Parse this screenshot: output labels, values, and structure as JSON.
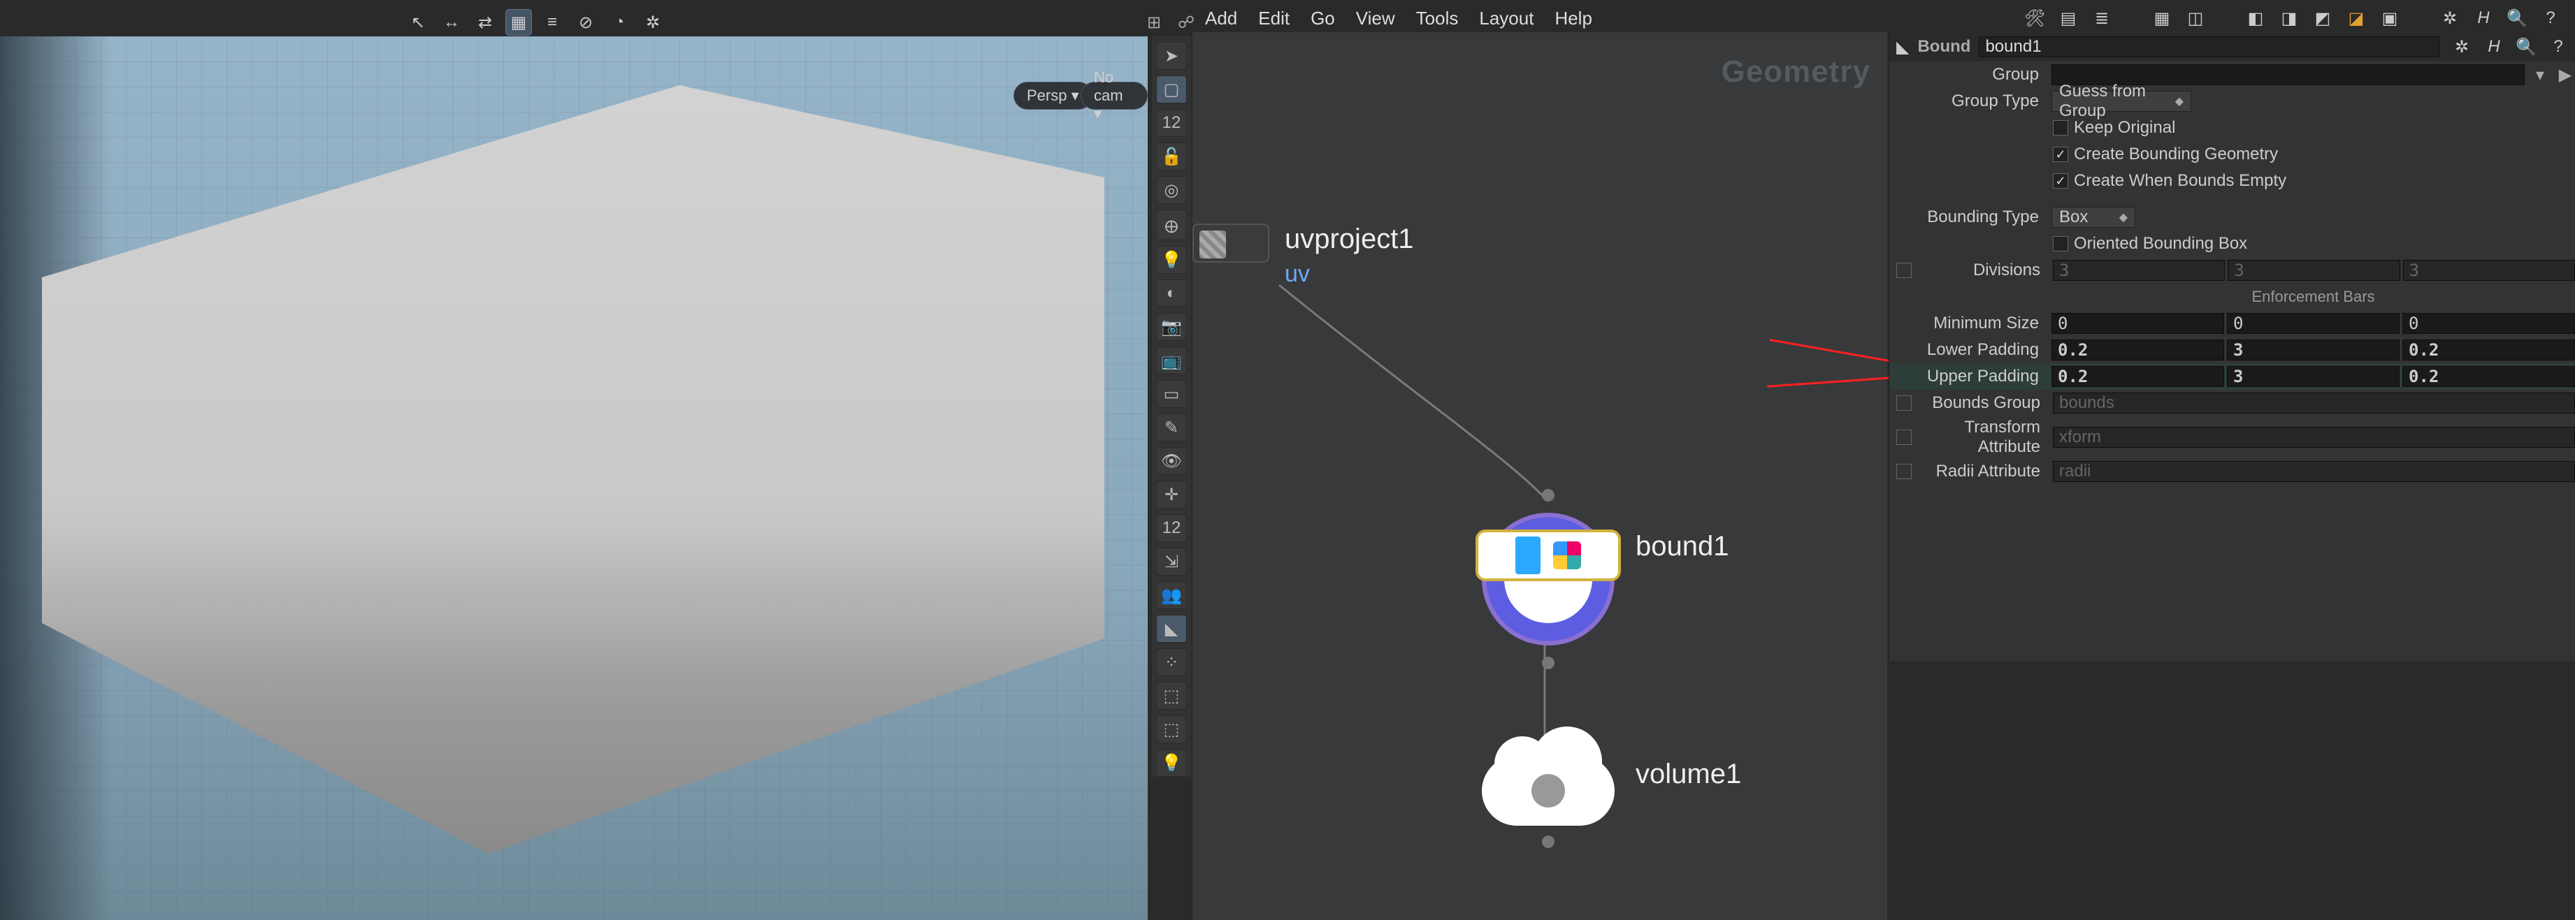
{
  "viewport": {
    "view_label": "Persp ▾",
    "camera_label": "No cam ▾"
  },
  "network": {
    "menu": [
      "Add",
      "Edit",
      "Go",
      "View",
      "Tools",
      "Layout",
      "Help"
    ],
    "title": "Geometry",
    "nodes": {
      "uvproject": {
        "name": "uvproject1",
        "subtitle": "uv"
      },
      "bound": {
        "name": "bound1"
      },
      "volume": {
        "name": "volume1"
      }
    }
  },
  "params": {
    "type_label": "Bound",
    "node_name": "bound1",
    "group_label": "Group",
    "group_value": "",
    "group_type_label": "Group Type",
    "group_type_value": "Guess from Group",
    "keep_original_label": "Keep Original",
    "keep_original_checked": false,
    "create_geo_label": "Create Bounding Geometry",
    "create_geo_checked": true,
    "create_empty_label": "Create When Bounds Empty",
    "create_empty_checked": true,
    "bounding_type_label": "Bounding Type",
    "bounding_type_value": "Box",
    "oriented_label": "Oriented Bounding Box",
    "oriented_checked": false,
    "divisions_label": "Divisions",
    "divisions": [
      "3",
      "3",
      "3"
    ],
    "enforcement_label": "Enforcement Bars",
    "min_size_label": "Minimum Size",
    "min_size": [
      "0",
      "0",
      "0"
    ],
    "lower_pad_label": "Lower Padding",
    "lower_pad": [
      "0.2",
      "3",
      "0.2"
    ],
    "upper_pad_label": "Upper Padding",
    "upper_pad": [
      "0.2",
      "3",
      "0.2"
    ],
    "bounds_group_label": "Bounds Group",
    "bounds_group_value": "bounds",
    "xform_attr_label": "Transform Attribute",
    "xform_attr_value": "xform",
    "radii_attr_label": "Radii Attribute",
    "radii_attr_value": "radii"
  }
}
